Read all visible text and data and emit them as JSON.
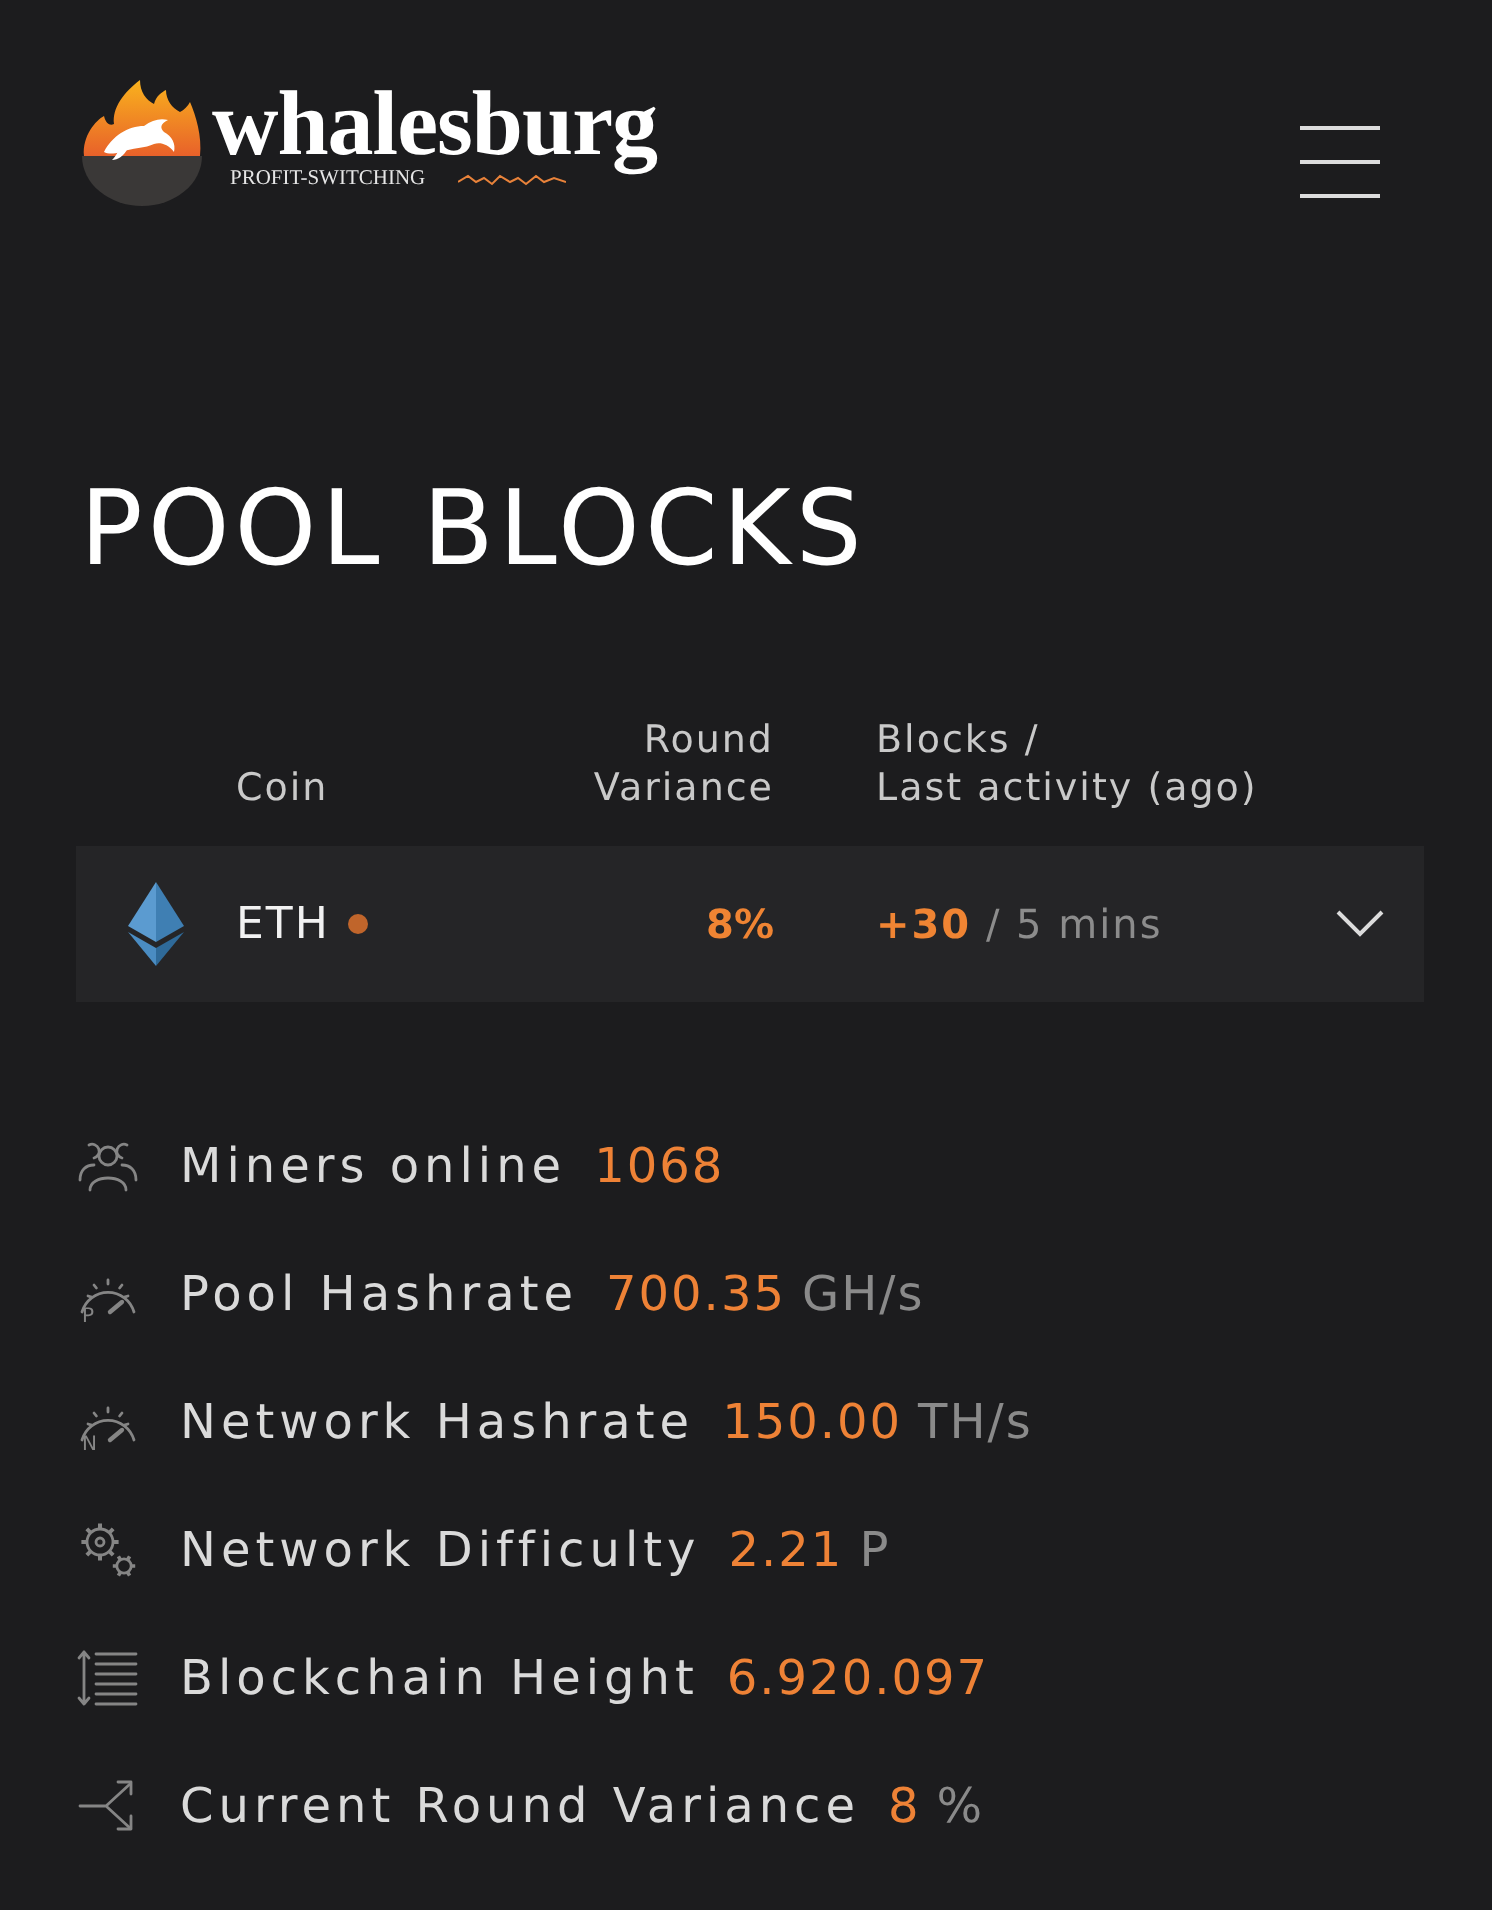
{
  "header": {
    "logo": {
      "wordmark": "whalesburg",
      "tagline": "PROFIT-SWITCHING"
    }
  },
  "page_title": "POOL BLOCKS",
  "table": {
    "columns": [
      {
        "lines": [
          "Coin"
        ]
      },
      {
        "lines": [
          "Round",
          "Variance"
        ]
      },
      {
        "lines": [
          "Blocks /",
          "Last activity (ago)"
        ]
      }
    ],
    "rows": [
      {
        "coin": "ETH",
        "color": "#c0652b",
        "round_variance": "8%",
        "blocks": "+30",
        "last_activity": "/ 5 mins",
        "expanded": false
      }
    ]
  },
  "stats": [
    {
      "kind": "miners",
      "label": "Miners online",
      "value": "1068"
    },
    {
      "kind": "pool_hashrate",
      "icon_letter": "P",
      "label": "Pool Hashrate",
      "value": "700.35",
      "unit": "GH/s"
    },
    {
      "kind": "network_hashrate",
      "icon_letter": "N",
      "label": "Network Hashrate",
      "value": "150.00",
      "unit": "TH/s"
    },
    {
      "kind": "difficulty",
      "label": "Network Difficulty",
      "value": "2.21",
      "unit": "P"
    },
    {
      "kind": "height",
      "label": "Blockchain Height",
      "value": "6.920.097"
    },
    {
      "kind": "variance",
      "label": "Current Round Variance",
      "value": "8",
      "unit": "%"
    }
  ]
}
